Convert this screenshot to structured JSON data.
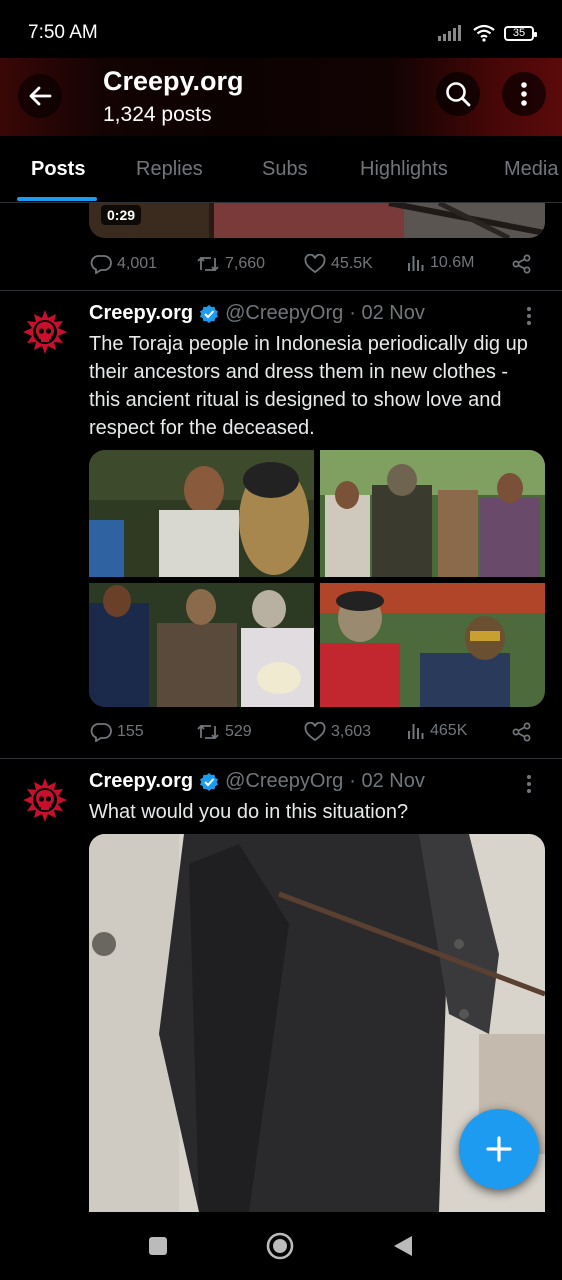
{
  "status_bar": {
    "time": "7:50 AM",
    "battery": "35"
  },
  "header": {
    "title": "Creepy.org",
    "subtitle": "1,324 posts"
  },
  "tabs": [
    {
      "label": "Posts"
    },
    {
      "label": "Replies"
    },
    {
      "label": "Subs"
    },
    {
      "label": "Highlights"
    },
    {
      "label": "Media"
    }
  ],
  "prev_post": {
    "duration": "0:29",
    "stats": {
      "replies": "4,001",
      "reposts": "7,660",
      "likes": "45.5K",
      "views": "10.6M"
    }
  },
  "posts": [
    {
      "name": "Creepy.org",
      "handle": "@CreepyOrg",
      "date": "· 02 Nov",
      "text": "The Toraja people in Indonesia periodically dig up their ancestors and dress them in new clothes - this ancient ritual is designed to show love and respect for the deceased.",
      "stats": {
        "replies": "155",
        "reposts": "529",
        "likes": "3,603",
        "views": "465K"
      }
    },
    {
      "name": "Creepy.org",
      "handle": "@CreepyOrg",
      "date": "· 02 Nov",
      "text": "What would you do in this situation?"
    }
  ],
  "colors": {
    "accent": "#1d9bf0",
    "brand_red": "#c8102e",
    "muted": "#71767b"
  },
  "icons": [
    "back-arrow",
    "search",
    "more-vertical",
    "reply",
    "repost",
    "like",
    "views",
    "share",
    "verified",
    "compose-plus",
    "nav-square",
    "nav-circle",
    "nav-triangle"
  ]
}
